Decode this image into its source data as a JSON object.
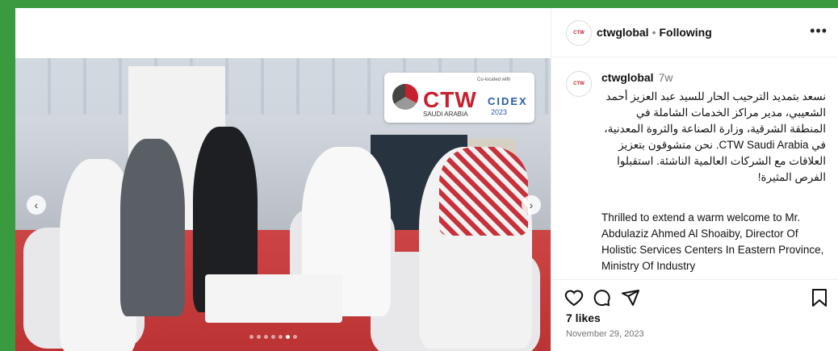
{
  "post": {
    "header": {
      "username": "ctwglobal",
      "separator": "•",
      "follow_status": "Following",
      "more_label": "•••"
    },
    "caption": {
      "username": "ctwglobal",
      "time_ago": "7w",
      "arabic_text": "نسعد بتمديد الترحيب الحار للسيد عبد العزيز أحمد الشعيبي، مدير مراكز الخدمات الشاملة في المنطقة الشرقية، وزارة الصناعة والثروة المعدنية، في CTW Saudi Arabia. نحن متشوقون بتعزيز العلاقات مع الشركات العالمية الناشئة. استقبلوا الفرص المثيرة!",
      "english_text": "Thrilled to extend a warm welcome to Mr. Abdulaziz Ahmed Al Shoaiby, Director Of Holistic Services Centers In Eastern Province, Ministry Of Industry"
    },
    "likes": "7 likes",
    "date": "November 29, 2023",
    "media": {
      "logo_main": "CTW",
      "logo_country": "SAUDI ARABIA",
      "logo_partner": "CIDEX",
      "logo_year": "2023",
      "logo_note": "Co-located with",
      "carousel_total": 7,
      "carousel_active": 6
    },
    "icons": {
      "like": "heart-icon",
      "comment": "comment-icon",
      "share": "share-icon",
      "save": "bookmark-icon",
      "prev": "chevron-left-icon",
      "next": "chevron-right-icon"
    }
  }
}
